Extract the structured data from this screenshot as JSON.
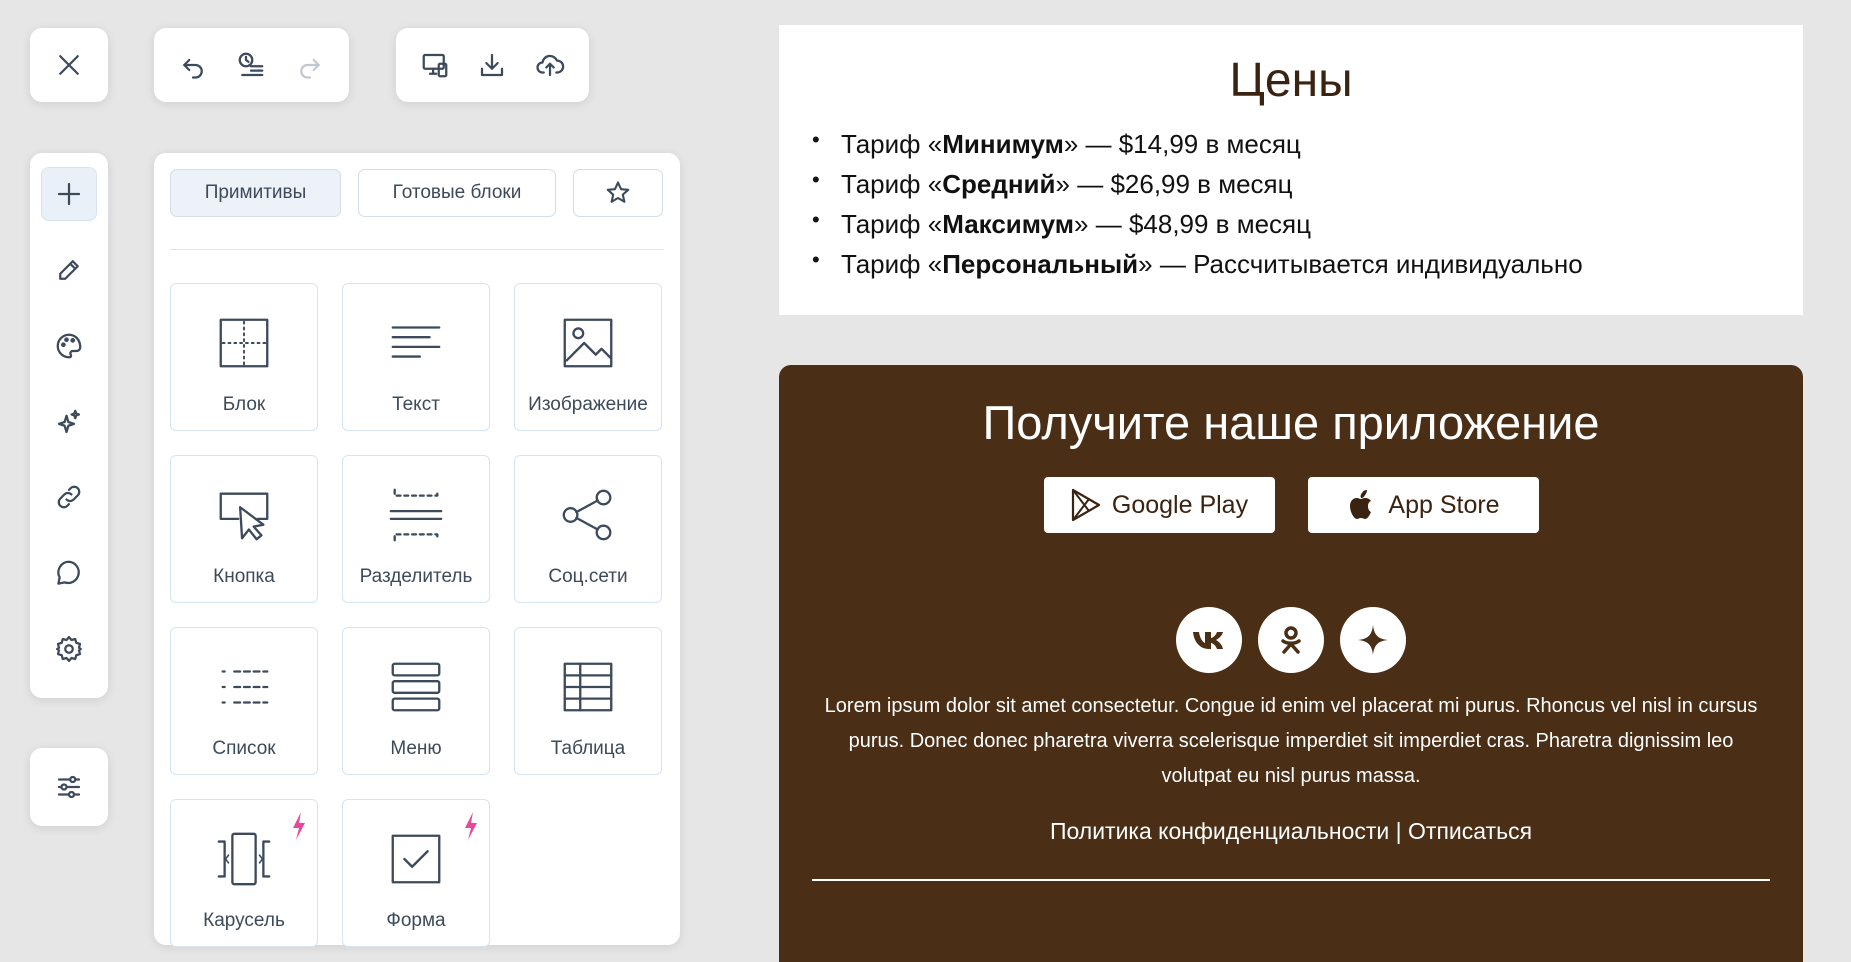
{
  "toolbar": {
    "close": "close-icon",
    "history": [
      "undo-icon",
      "history-icon",
      "redo-icon"
    ],
    "file": [
      "preview-icon",
      "download-icon",
      "upload-icon"
    ]
  },
  "sidebar": {
    "items": [
      "plus-icon",
      "pencil-icon",
      "palette-icon",
      "sparkles-icon",
      "link-icon",
      "comment-icon",
      "gear-icon"
    ],
    "bottom": "sliders-icon"
  },
  "panel": {
    "tabs": {
      "primitives": "Примитивы",
      "blocks": "Готовые блоки"
    },
    "tiles": {
      "block": "Блок",
      "text": "Текст",
      "image": "Изображение",
      "button": "Кнопка",
      "divider": "Разделитель",
      "social": "Соц.сети",
      "list": "Список",
      "menu": "Меню",
      "table": "Таблица",
      "carousel": "Карусель",
      "form": "Форма"
    },
    "pro_color": "#e8489b"
  },
  "pricing": {
    "title": "Цены",
    "plans": [
      {
        "prefix": "Тариф «",
        "name": "Минимум",
        "suffix": "» — $14,99 в месяц"
      },
      {
        "prefix": "Тариф «",
        "name": "Средний",
        "suffix": "» — $26,99 в месяц"
      },
      {
        "prefix": "Тариф «",
        "name": "Максимум",
        "suffix": "» — $48,99 в месяц"
      },
      {
        "prefix": "Тариф «",
        "name": "Персональный",
        "suffix": "» — Рассчитывается индивидуально"
      }
    ]
  },
  "app": {
    "title": "Получите наше приложение",
    "google_play": "Google Play",
    "app_store": "App Store",
    "socials": [
      "vk-icon",
      "ok-icon",
      "sparkle-icon"
    ],
    "lorem": "Lorem ipsum dolor sit amet consectetur. Congue id enim vel placerat mi purus. Rhoncus vel nisl in cursus purus. Donec donec pharetra viverra scelerisque imperdiet sit imperdiet cras. Pharetra dignissim leo volutpat eu nisl purus massa.",
    "privacy": "Политика конфиденциальности",
    "separator": " | ",
    "unsubscribe": "Отписаться",
    "bg_color": "#4a2e16"
  }
}
